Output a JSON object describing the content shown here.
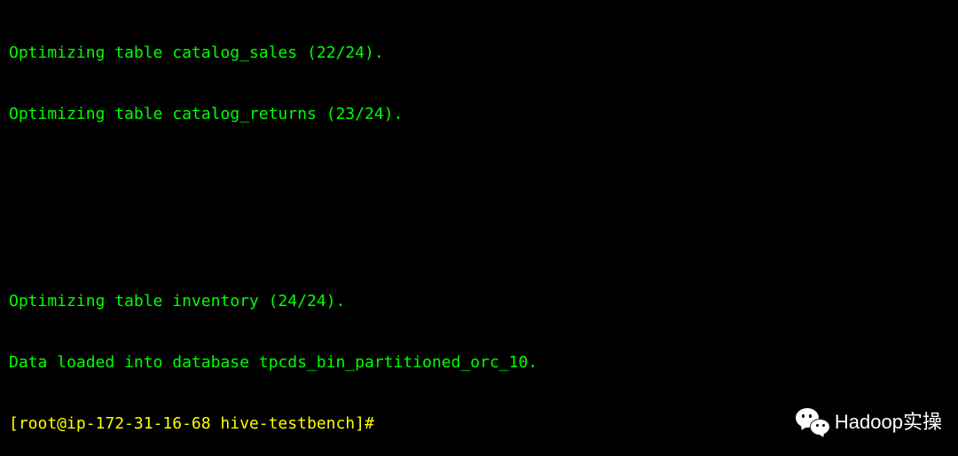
{
  "terminal": {
    "top_lines": [
      "Optimizing table catalog_sales (22/24).",
      "Optimizing table catalog_returns (23/24)."
    ],
    "bottom_lines": [
      "Optimizing table inventory (24/24).",
      "Data loaded into database tpcds_bin_partitioned_orc_10."
    ],
    "prompt": "[root@ip-172-31-16-68 hive-testbench]#"
  },
  "watermark": {
    "text": "Hadoop实操"
  }
}
